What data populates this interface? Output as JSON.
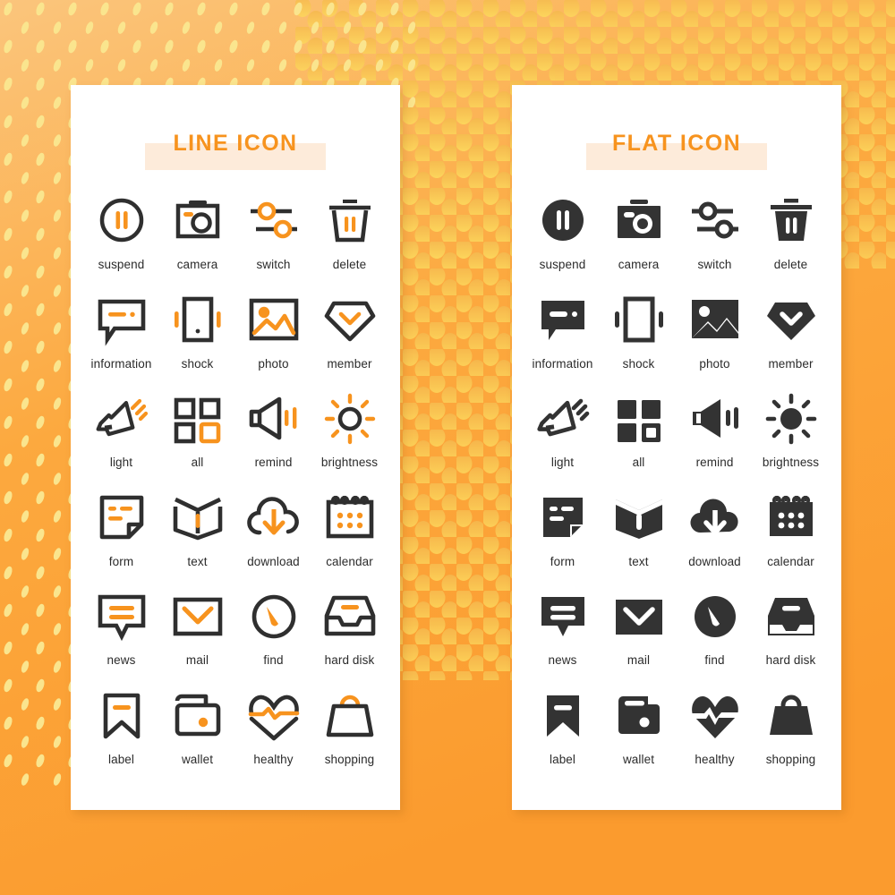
{
  "background": {
    "base_color": "#FCA03E",
    "gradient_top_color": "#FBC77E",
    "gradient_bottom_color": "#FB9E33",
    "speck_color": "#FAE38A",
    "halftone_dot_color": "#F9C75C"
  },
  "panels": [
    {
      "id": "line",
      "title": "LINE ICON",
      "title_color": "#F7931E",
      "title_band_color": "#FDEBDA",
      "style": "line",
      "stroke_color": "#2F2F2F",
      "accent_color": "#F7931E",
      "icons": [
        {
          "name": "suspend",
          "icon": "pause-circle-icon"
        },
        {
          "name": "camera",
          "icon": "camera-icon"
        },
        {
          "name": "switch",
          "icon": "sliders-icon"
        },
        {
          "name": "delete",
          "icon": "trash-icon"
        },
        {
          "name": "information",
          "icon": "speech-bubble-icon"
        },
        {
          "name": "shock",
          "icon": "vibrate-phone-icon"
        },
        {
          "name": "photo",
          "icon": "image-icon"
        },
        {
          "name": "member",
          "icon": "diamond-chevron-icon"
        },
        {
          "name": "light",
          "icon": "flashlight-icon"
        },
        {
          "name": "all",
          "icon": "grid-squares-icon"
        },
        {
          "name": "remind",
          "icon": "speaker-icon"
        },
        {
          "name": "brightness",
          "icon": "sun-icon"
        },
        {
          "name": "form",
          "icon": "document-fold-icon"
        },
        {
          "name": "text",
          "icon": "open-book-icon"
        },
        {
          "name": "download",
          "icon": "cloud-download-icon"
        },
        {
          "name": "calendar",
          "icon": "calendar-icon"
        },
        {
          "name": "news",
          "icon": "news-bubble-icon"
        },
        {
          "name": "mail",
          "icon": "mail-icon"
        },
        {
          "name": "find",
          "icon": "compass-icon"
        },
        {
          "name": "hard disk",
          "icon": "hard-disk-icon"
        },
        {
          "name": "label",
          "icon": "bookmark-icon"
        },
        {
          "name": "wallet",
          "icon": "wallet-icon"
        },
        {
          "name": "healthy",
          "icon": "heart-pulse-icon"
        },
        {
          "name": "shopping",
          "icon": "shopping-bag-icon"
        }
      ]
    },
    {
      "id": "flat",
      "title": "FLAT ICON",
      "title_color": "#F7931E",
      "title_band_color": "#FDEBDA",
      "style": "flat",
      "fill_color": "#333333",
      "icons": [
        {
          "name": "suspend",
          "icon": "pause-circle-icon"
        },
        {
          "name": "camera",
          "icon": "camera-icon"
        },
        {
          "name": "switch",
          "icon": "sliders-icon"
        },
        {
          "name": "delete",
          "icon": "trash-icon"
        },
        {
          "name": "information",
          "icon": "speech-bubble-icon"
        },
        {
          "name": "shock",
          "icon": "vibrate-phone-icon"
        },
        {
          "name": "photo",
          "icon": "image-icon"
        },
        {
          "name": "member",
          "icon": "diamond-chevron-icon"
        },
        {
          "name": "light",
          "icon": "flashlight-icon"
        },
        {
          "name": "all",
          "icon": "grid-squares-icon"
        },
        {
          "name": "remind",
          "icon": "speaker-icon"
        },
        {
          "name": "brightness",
          "icon": "sun-icon"
        },
        {
          "name": "form",
          "icon": "document-fold-icon"
        },
        {
          "name": "text",
          "icon": "open-book-icon"
        },
        {
          "name": "download",
          "icon": "cloud-download-icon"
        },
        {
          "name": "calendar",
          "icon": "calendar-icon"
        },
        {
          "name": "news",
          "icon": "news-bubble-icon"
        },
        {
          "name": "mail",
          "icon": "mail-icon"
        },
        {
          "name": "find",
          "icon": "compass-icon"
        },
        {
          "name": "hard disk",
          "icon": "hard-disk-icon"
        },
        {
          "name": "label",
          "icon": "bookmark-icon"
        },
        {
          "name": "wallet",
          "icon": "wallet-icon"
        },
        {
          "name": "healthy",
          "icon": "heart-pulse-icon"
        },
        {
          "name": "shopping",
          "icon": "shopping-bag-icon"
        }
      ]
    }
  ]
}
